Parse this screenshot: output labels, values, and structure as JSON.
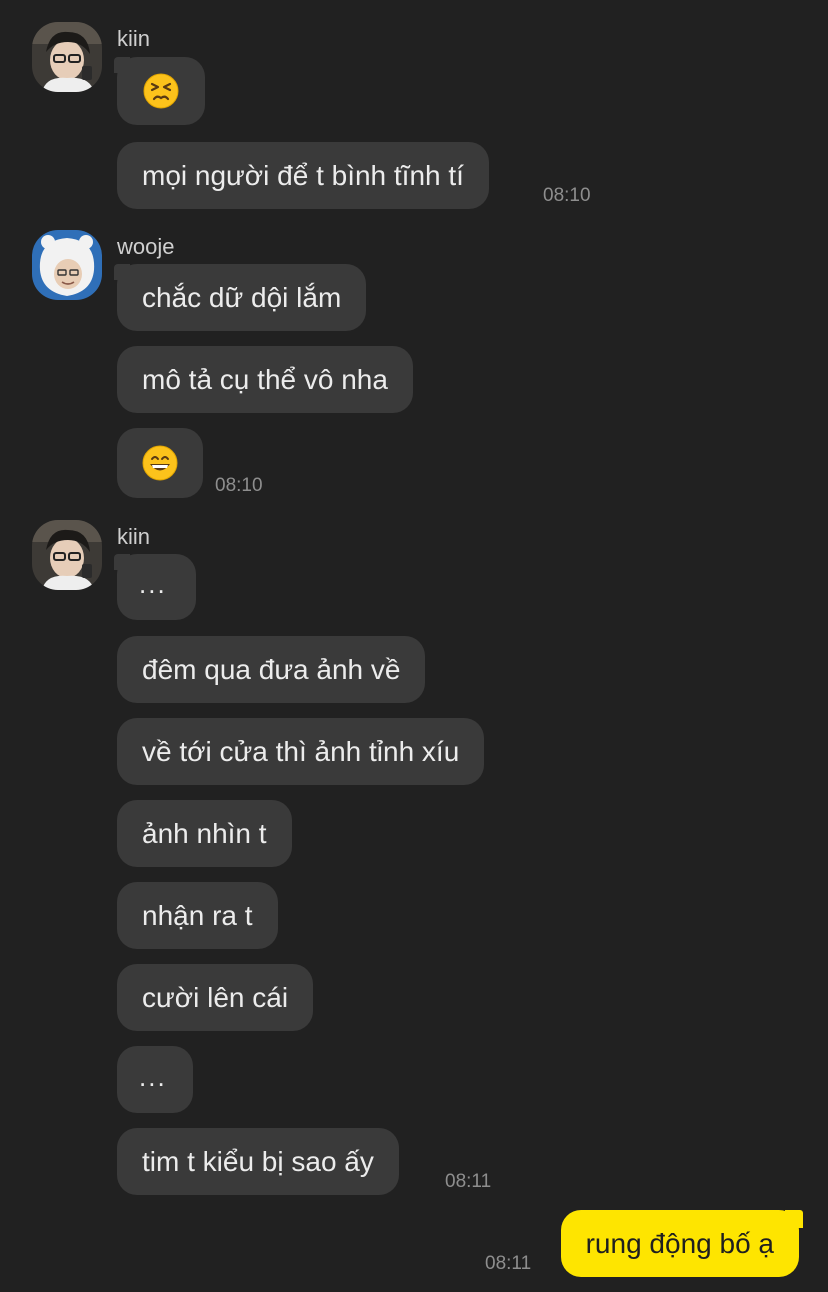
{
  "groups": [
    {
      "sender": "kiin",
      "messages": [
        {
          "type": "emoji",
          "icon": "persevering-face-emoji"
        },
        {
          "type": "text",
          "text": "mọi người để t bình tĩnh tí",
          "time": "08:10"
        }
      ]
    },
    {
      "sender": "wooje",
      "messages": [
        {
          "type": "text",
          "text": "chắc dữ dội lắm"
        },
        {
          "type": "text",
          "text": "mô tả cụ thể vô nha"
        },
        {
          "type": "emoji",
          "icon": "grinning-face-emoji",
          "time": "08:10"
        }
      ]
    },
    {
      "sender": "kiin",
      "messages": [
        {
          "type": "text",
          "text": "..."
        },
        {
          "type": "text",
          "text": "đêm qua đưa ảnh về"
        },
        {
          "type": "text",
          "text": "về tới cửa thì ảnh tỉnh xíu"
        },
        {
          "type": "text",
          "text": "ảnh nhìn t"
        },
        {
          "type": "text",
          "text": "nhận ra t"
        },
        {
          "type": "text",
          "text": "cười lên cái"
        },
        {
          "type": "text",
          "text": "..."
        },
        {
          "type": "text",
          "text": "tim t kiểu bị sao ấy",
          "time": "08:11"
        }
      ]
    }
  ],
  "my_message": {
    "text": "rung động bố ạ",
    "time": "08:11"
  },
  "colors": {
    "background": "#212121",
    "bubble_other": "#3a3a3a",
    "bubble_mine": "#fee500",
    "timestamp": "#8e8e8e"
  }
}
